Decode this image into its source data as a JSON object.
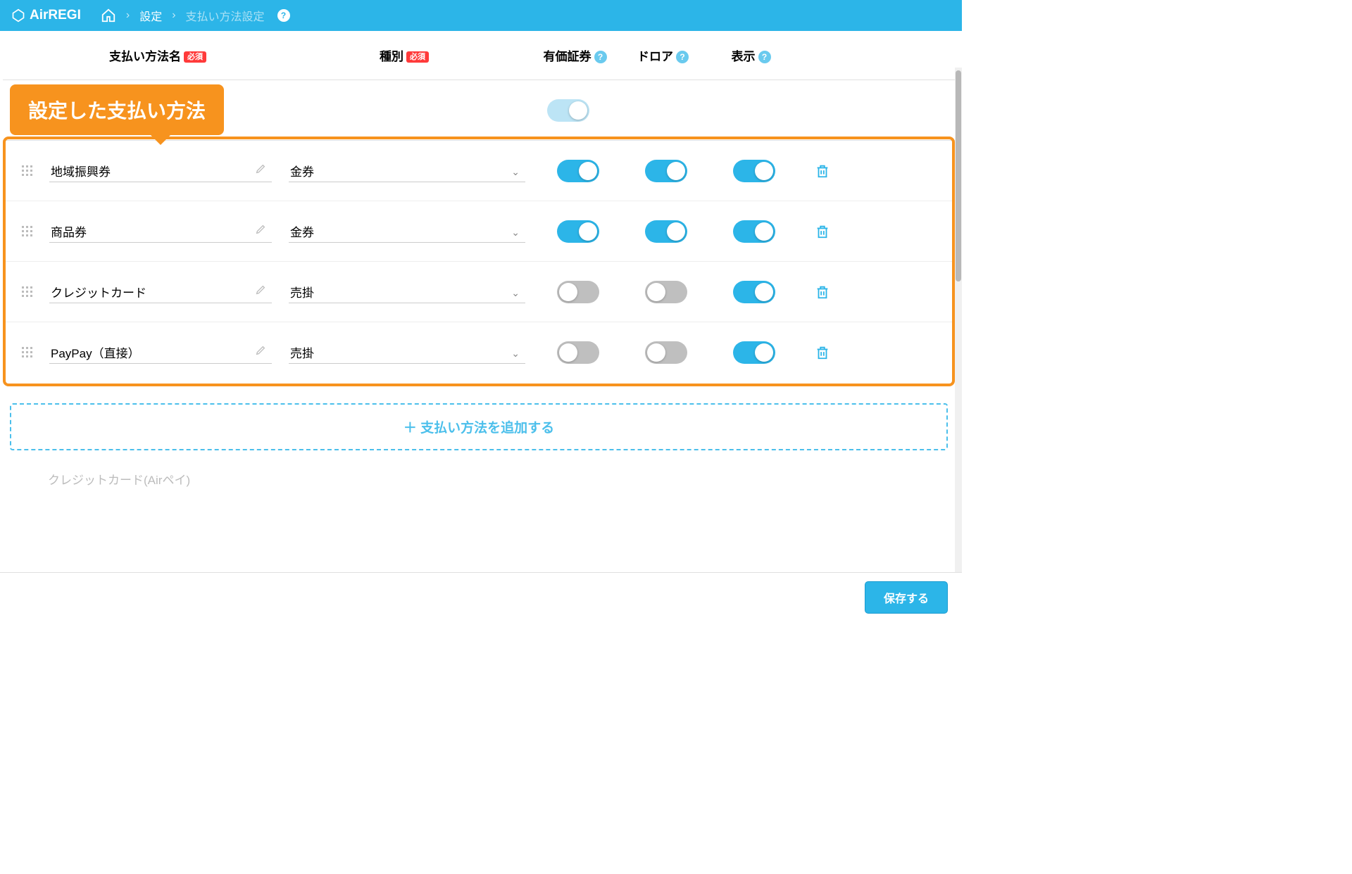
{
  "brand": "AirREGI",
  "breadcrumb": {
    "settings": "設定",
    "current": "支払い方法設定"
  },
  "columns": {
    "name": "支払い方法名",
    "type": "種別",
    "securities": "有価証券",
    "drawer": "ドロア",
    "display": "表示",
    "required": "必須"
  },
  "callout": "設定した支払い方法",
  "rows": [
    {
      "name": "地域振興券",
      "type": "金券",
      "sec": true,
      "drawer": true,
      "disp": true
    },
    {
      "name": "商品券",
      "type": "金券",
      "sec": true,
      "drawer": true,
      "disp": true
    },
    {
      "name": "クレジットカード",
      "type": "売掛",
      "sec": false,
      "drawer": false,
      "disp": true
    },
    {
      "name": "PayPay（直接）",
      "type": "売掛",
      "sec": false,
      "drawer": false,
      "disp": true
    }
  ],
  "add_label": "＋ 支払い方法を追加する",
  "faded_item": "クレジットカード(Airペイ)",
  "save_label": "保存する"
}
